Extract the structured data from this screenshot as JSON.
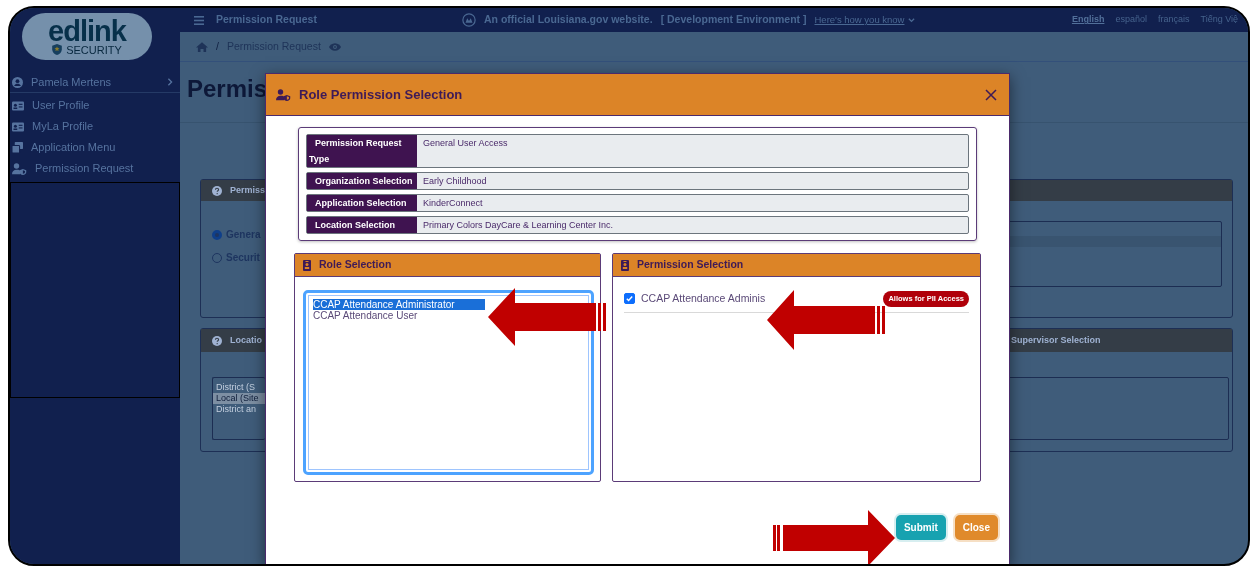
{
  "sidebar": {
    "logo": {
      "wordmark": "edlink",
      "tagline": "SECURITY"
    },
    "user": "Pamela Mertens",
    "items": [
      {
        "label": "User Profile"
      },
      {
        "label": "MyLa Profile"
      },
      {
        "label": "Application Menu"
      },
      {
        "label": "Permission Request"
      }
    ]
  },
  "top_bar": {
    "page_title": "Permission Request",
    "official_notice": "An official Louisiana.gov website.",
    "environment": "[ Development Environment ]",
    "how_you_know": "Here's how you know",
    "languages": [
      {
        "label": "English",
        "selected": true
      },
      {
        "label": "español",
        "selected": false
      },
      {
        "label": "français",
        "selected": false
      },
      {
        "label": "Tiếng Việ",
        "selected": false
      }
    ]
  },
  "breadcrumb": {
    "separator": "/",
    "current": "Permission Request"
  },
  "page": {
    "title": "Permis",
    "request_card": {
      "title": "Permiss",
      "options": [
        {
          "label": "Genera",
          "selected": true
        },
        {
          "label": "Securit",
          "selected": false
        }
      ]
    },
    "location_card": {
      "title": "Locatio",
      "side_title": "Supervisor Selection",
      "options": [
        {
          "label": "District (S",
          "selected": false
        },
        {
          "label": "Local (Site",
          "selected": true
        },
        {
          "label": "District an",
          "selected": false
        }
      ]
    }
  },
  "modal": {
    "title": "Role Permission Selection",
    "summary": [
      {
        "label": "Permission Request Type",
        "value": "General User Access"
      },
      {
        "label": "Organization Selection",
        "value": "Early Childhood"
      },
      {
        "label": "Application Selection",
        "value": "KinderConnect"
      },
      {
        "label": "Location Selection",
        "value": "Primary Colors DayCare & Learning Center Inc."
      }
    ],
    "role_selection": {
      "title": "Role Selection",
      "options": [
        {
          "label": "CCAP Attendance Administrator",
          "selected": true
        },
        {
          "label": "CCAP Attendance User",
          "selected": false
        }
      ]
    },
    "permission_selection": {
      "title": "Permission Selection",
      "items": [
        {
          "label": "CCAP Attendance Adminis",
          "checked": true,
          "badge": "Allows for PII Access"
        }
      ]
    },
    "buttons": [
      {
        "label": "Submit",
        "kind": "primary"
      },
      {
        "label": "Close",
        "kind": "secondary"
      }
    ]
  }
}
